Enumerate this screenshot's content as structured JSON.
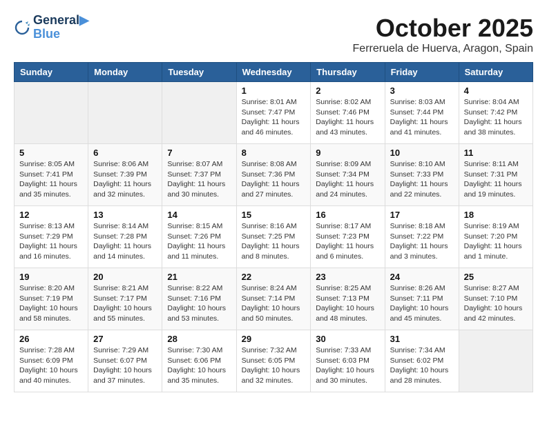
{
  "header": {
    "logo_line1": "General",
    "logo_line2": "Blue",
    "month": "October 2025",
    "location": "Ferreruela de Huerva, Aragon, Spain"
  },
  "weekdays": [
    "Sunday",
    "Monday",
    "Tuesday",
    "Wednesday",
    "Thursday",
    "Friday",
    "Saturday"
  ],
  "weeks": [
    [
      {
        "day": "",
        "info": ""
      },
      {
        "day": "",
        "info": ""
      },
      {
        "day": "",
        "info": ""
      },
      {
        "day": "1",
        "info": "Sunrise: 8:01 AM\nSunset: 7:47 PM\nDaylight: 11 hours and 46 minutes."
      },
      {
        "day": "2",
        "info": "Sunrise: 8:02 AM\nSunset: 7:46 PM\nDaylight: 11 hours and 43 minutes."
      },
      {
        "day": "3",
        "info": "Sunrise: 8:03 AM\nSunset: 7:44 PM\nDaylight: 11 hours and 41 minutes."
      },
      {
        "day": "4",
        "info": "Sunrise: 8:04 AM\nSunset: 7:42 PM\nDaylight: 11 hours and 38 minutes."
      }
    ],
    [
      {
        "day": "5",
        "info": "Sunrise: 8:05 AM\nSunset: 7:41 PM\nDaylight: 11 hours and 35 minutes."
      },
      {
        "day": "6",
        "info": "Sunrise: 8:06 AM\nSunset: 7:39 PM\nDaylight: 11 hours and 32 minutes."
      },
      {
        "day": "7",
        "info": "Sunrise: 8:07 AM\nSunset: 7:37 PM\nDaylight: 11 hours and 30 minutes."
      },
      {
        "day": "8",
        "info": "Sunrise: 8:08 AM\nSunset: 7:36 PM\nDaylight: 11 hours and 27 minutes."
      },
      {
        "day": "9",
        "info": "Sunrise: 8:09 AM\nSunset: 7:34 PM\nDaylight: 11 hours and 24 minutes."
      },
      {
        "day": "10",
        "info": "Sunrise: 8:10 AM\nSunset: 7:33 PM\nDaylight: 11 hours and 22 minutes."
      },
      {
        "day": "11",
        "info": "Sunrise: 8:11 AM\nSunset: 7:31 PM\nDaylight: 11 hours and 19 minutes."
      }
    ],
    [
      {
        "day": "12",
        "info": "Sunrise: 8:13 AM\nSunset: 7:29 PM\nDaylight: 11 hours and 16 minutes."
      },
      {
        "day": "13",
        "info": "Sunrise: 8:14 AM\nSunset: 7:28 PM\nDaylight: 11 hours and 14 minutes."
      },
      {
        "day": "14",
        "info": "Sunrise: 8:15 AM\nSunset: 7:26 PM\nDaylight: 11 hours and 11 minutes."
      },
      {
        "day": "15",
        "info": "Sunrise: 8:16 AM\nSunset: 7:25 PM\nDaylight: 11 hours and 8 minutes."
      },
      {
        "day": "16",
        "info": "Sunrise: 8:17 AM\nSunset: 7:23 PM\nDaylight: 11 hours and 6 minutes."
      },
      {
        "day": "17",
        "info": "Sunrise: 8:18 AM\nSunset: 7:22 PM\nDaylight: 11 hours and 3 minutes."
      },
      {
        "day": "18",
        "info": "Sunrise: 8:19 AM\nSunset: 7:20 PM\nDaylight: 11 hours and 1 minute."
      }
    ],
    [
      {
        "day": "19",
        "info": "Sunrise: 8:20 AM\nSunset: 7:19 PM\nDaylight: 10 hours and 58 minutes."
      },
      {
        "day": "20",
        "info": "Sunrise: 8:21 AM\nSunset: 7:17 PM\nDaylight: 10 hours and 55 minutes."
      },
      {
        "day": "21",
        "info": "Sunrise: 8:22 AM\nSunset: 7:16 PM\nDaylight: 10 hours and 53 minutes."
      },
      {
        "day": "22",
        "info": "Sunrise: 8:24 AM\nSunset: 7:14 PM\nDaylight: 10 hours and 50 minutes."
      },
      {
        "day": "23",
        "info": "Sunrise: 8:25 AM\nSunset: 7:13 PM\nDaylight: 10 hours and 48 minutes."
      },
      {
        "day": "24",
        "info": "Sunrise: 8:26 AM\nSunset: 7:11 PM\nDaylight: 10 hours and 45 minutes."
      },
      {
        "day": "25",
        "info": "Sunrise: 8:27 AM\nSunset: 7:10 PM\nDaylight: 10 hours and 42 minutes."
      }
    ],
    [
      {
        "day": "26",
        "info": "Sunrise: 7:28 AM\nSunset: 6:09 PM\nDaylight: 10 hours and 40 minutes."
      },
      {
        "day": "27",
        "info": "Sunrise: 7:29 AM\nSunset: 6:07 PM\nDaylight: 10 hours and 37 minutes."
      },
      {
        "day": "28",
        "info": "Sunrise: 7:30 AM\nSunset: 6:06 PM\nDaylight: 10 hours and 35 minutes."
      },
      {
        "day": "29",
        "info": "Sunrise: 7:32 AM\nSunset: 6:05 PM\nDaylight: 10 hours and 32 minutes."
      },
      {
        "day": "30",
        "info": "Sunrise: 7:33 AM\nSunset: 6:03 PM\nDaylight: 10 hours and 30 minutes."
      },
      {
        "day": "31",
        "info": "Sunrise: 7:34 AM\nSunset: 6:02 PM\nDaylight: 10 hours and 28 minutes."
      },
      {
        "day": "",
        "info": ""
      }
    ]
  ]
}
